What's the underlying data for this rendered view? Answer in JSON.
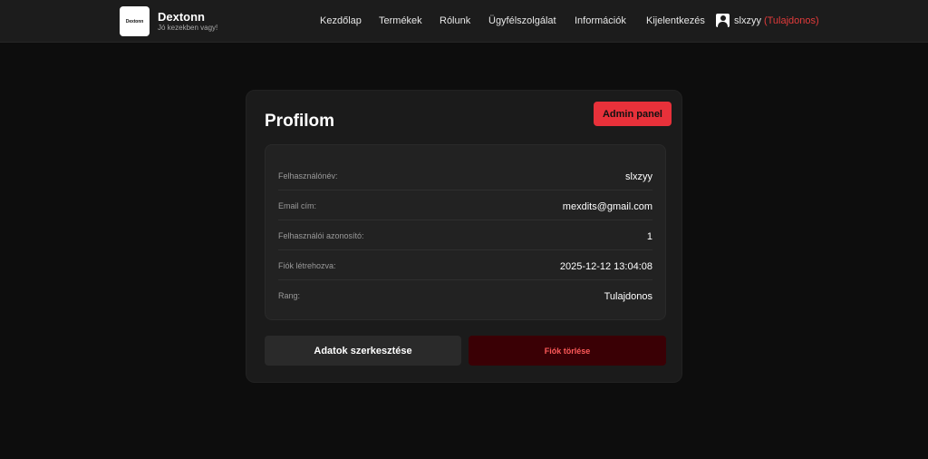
{
  "header": {
    "logo_text": "Dextonn",
    "brand_name": "Dextonn",
    "tagline": "Jó kezekben vagy!",
    "nav": [
      {
        "label": "Kezdőlap"
      },
      {
        "label": "Termékek"
      },
      {
        "label": "Rólunk"
      },
      {
        "label": "Ügyfélszolgálat"
      },
      {
        "label": "Információk"
      },
      {
        "label": "Kijelentkezés"
      }
    ],
    "user": {
      "name": "slxzyy",
      "role": "(Tulajdonos)",
      "icon": "user-icon"
    }
  },
  "profile": {
    "title": "Profilom",
    "admin_button": "Admin panel",
    "rows": [
      {
        "label": "Felhasználónév:",
        "value": "slxzyy"
      },
      {
        "label": "Email cím:",
        "value": "mexdits@gmail.com"
      },
      {
        "label": "Felhasználói azonosító:",
        "value": "1"
      },
      {
        "label": "Fiók létrehozva:",
        "value": "2025-12-12 13:04:08"
      },
      {
        "label": "Rang:",
        "value": "Tulajdonos"
      }
    ],
    "edit_button": "Adatok szerkesztése",
    "delete_button": "Fiók törlése"
  },
  "colors": {
    "accent": "#e8313a",
    "danger_bg": "#3a0005",
    "role_text": "#e23b3b"
  }
}
